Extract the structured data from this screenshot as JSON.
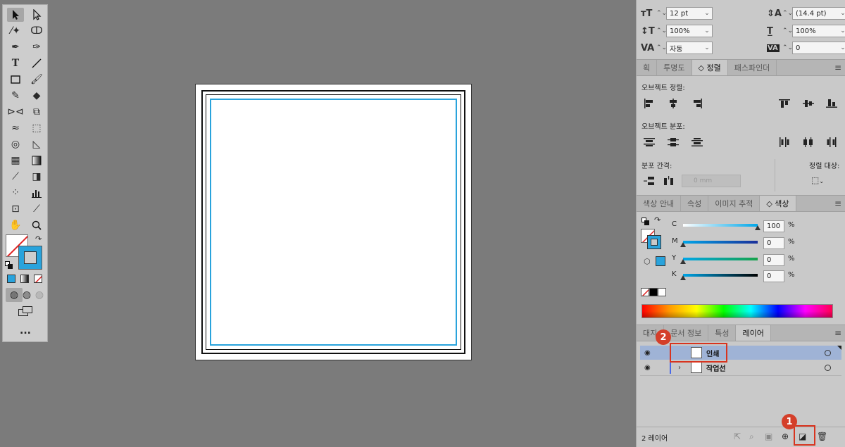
{
  "character": {
    "font_size": "12 pt",
    "leading": "(14.4 pt)",
    "vertical_scale": "100%",
    "horizontal_scale": "100%",
    "kerning": "자동",
    "tracking": "0"
  },
  "align_panel": {
    "tabs": [
      "획",
      "투명도",
      "◇ 정렬",
      "패스파인더"
    ],
    "object_align_label": "오브젝트 정렬:",
    "object_distribute_label": "오브젝트 분포:",
    "distribute_spacing_label": "분포 간격:",
    "align_to_label": "정렬 대상:",
    "spacing_value": "0 mm"
  },
  "color_panel": {
    "tabs": [
      "색상 안내",
      "속성",
      "이미지 추적",
      "◇ 색상"
    ],
    "channels": [
      {
        "label": "C",
        "value": "100",
        "percent": "%",
        "fill": 1.0
      },
      {
        "label": "M",
        "value": "0",
        "percent": "%",
        "fill": 0.0
      },
      {
        "label": "Y",
        "value": "0",
        "percent": "%",
        "fill": 0.0
      },
      {
        "label": "K",
        "value": "0",
        "percent": "%",
        "fill": 0.0
      }
    ],
    "accent": "#29a3dc"
  },
  "layers_panel": {
    "tabs": [
      "대지",
      "문서 정보",
      "특성",
      "레이어"
    ],
    "layers": [
      {
        "name": "인쇄",
        "selected": true
      },
      {
        "name": "작업선",
        "selected": false
      }
    ],
    "count_label": "2 레이어"
  },
  "callouts": [
    "1",
    "2"
  ],
  "toolbox": {
    "more_label": "..."
  }
}
